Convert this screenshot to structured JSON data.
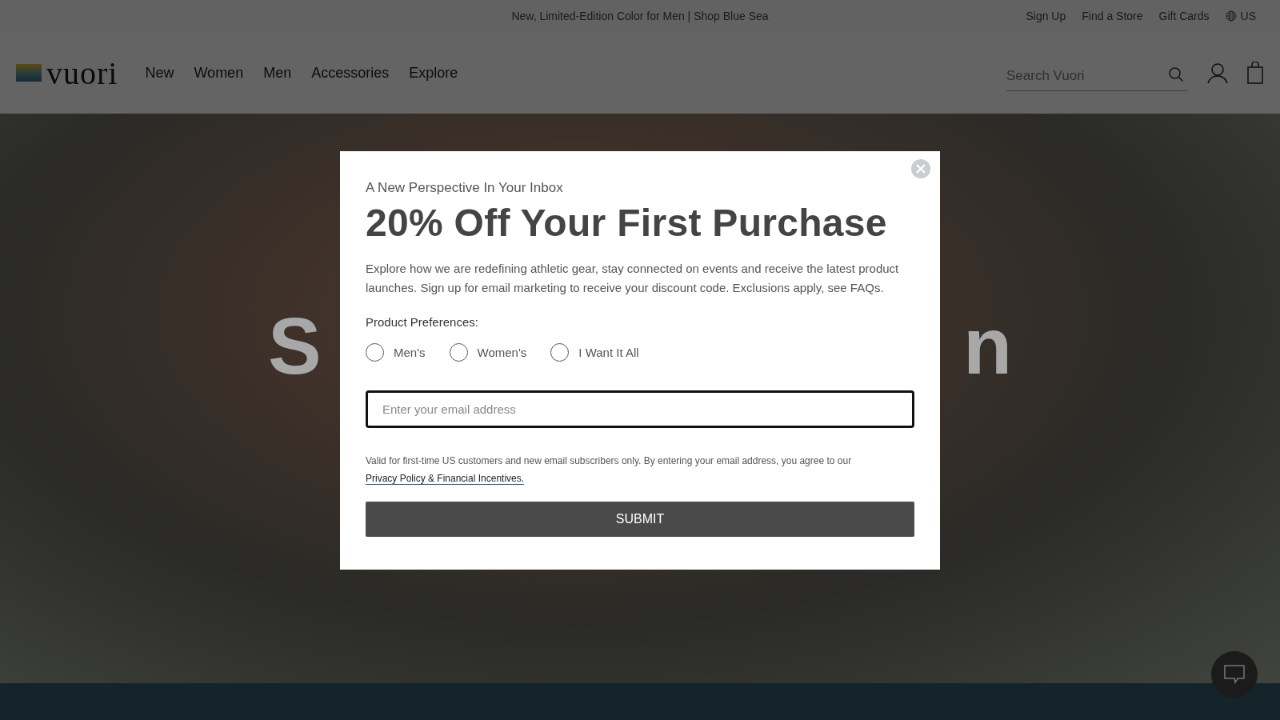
{
  "promo_bar": {
    "message": "New, Limited-Edition Color for Men | Shop Blue Sea",
    "links": [
      "Sign Up",
      "Find a Store",
      "Gift Cards"
    ],
    "region": "US"
  },
  "header": {
    "logo": "vuori",
    "nav": [
      "New",
      "Women",
      "Men",
      "Accessories",
      "Explore"
    ],
    "search": {
      "placeholder": "Search Vuori"
    }
  },
  "hero": {
    "title_fragments": [
      "S",
      "n"
    ]
  },
  "modal": {
    "eyebrow": "A New Perspective In Your Inbox",
    "title": "20% Off Your First Purchase",
    "description": "Explore how we are redefining athletic gear, stay connected on events and receive the latest product launches. Sign up for email marketing to receive your discount code. Exclusions apply, see FAQs.",
    "preferences_label": "Product Preferences:",
    "preferences": [
      {
        "label": "Men's",
        "selected": false
      },
      {
        "label": "Women's",
        "selected": false
      },
      {
        "label": "I Want It All",
        "selected": false
      }
    ],
    "email": {
      "placeholder": "Enter your email address"
    },
    "disclaimer": "Valid for first-time US customers and new email subscribers only. By entering your email address, you agree to our",
    "disclaimer_link": "Privacy Policy & Financial Incentives.",
    "submit": "SUBMIT"
  }
}
